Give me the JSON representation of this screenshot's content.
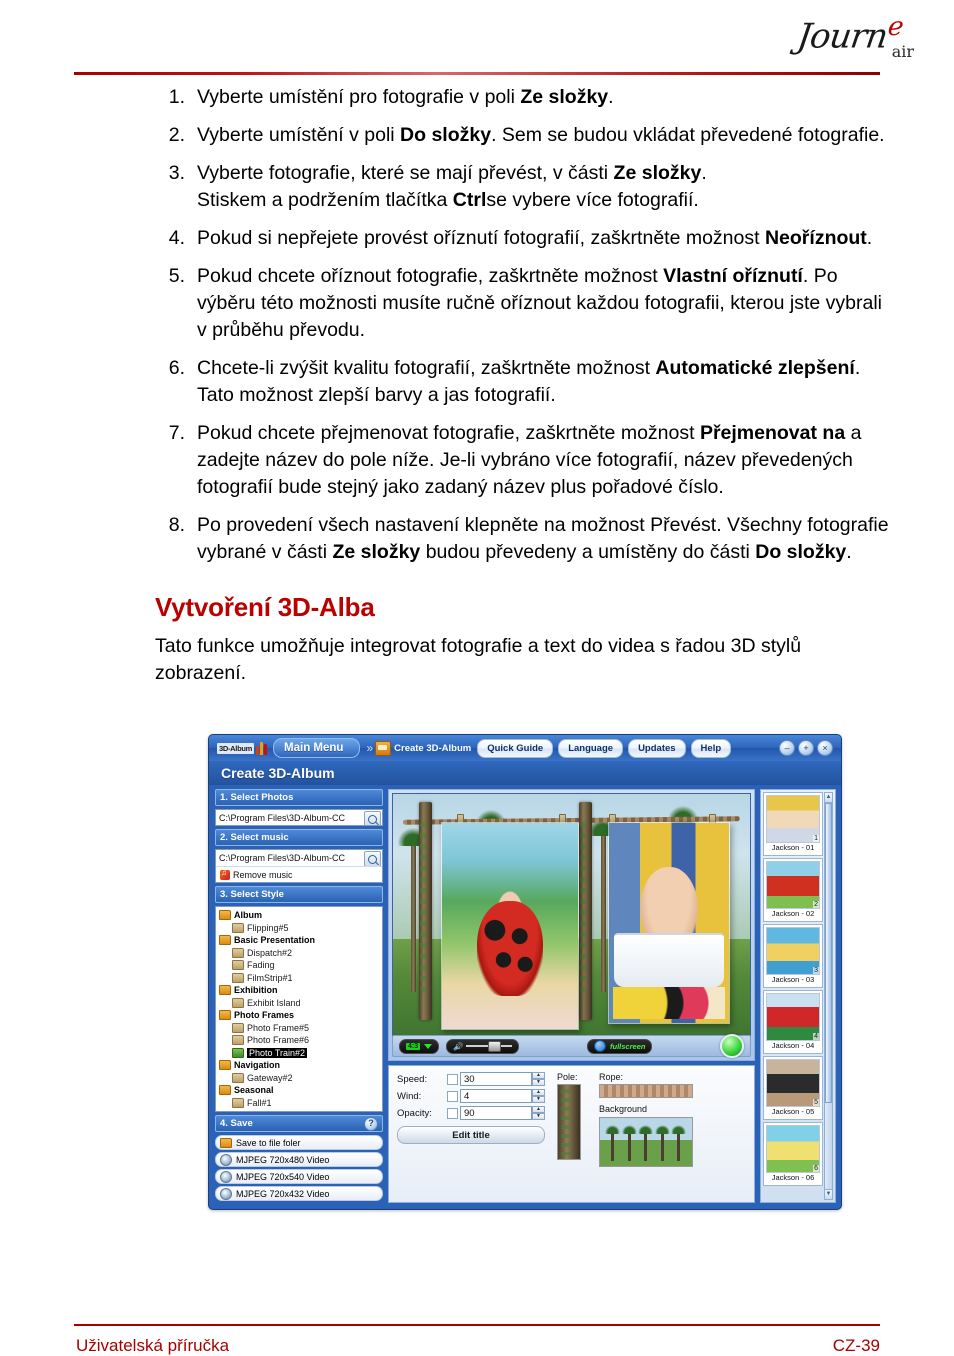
{
  "header": {
    "brand_main": "Journ",
    "brand_accent": "e",
    "brand_sub": "air"
  },
  "steps": [
    {
      "num": "1.",
      "parts": [
        {
          "t": "Vyberte umístění pro fotografie v poli ",
          "b": false
        },
        {
          "t": "Ze složky",
          "b": true
        },
        {
          "t": ".",
          "b": false
        }
      ]
    },
    {
      "num": "2.",
      "parts": [
        {
          "t": "Vyberte umístění v poli ",
          "b": false
        },
        {
          "t": "Do složky",
          "b": true
        },
        {
          "t": ". Sem se budou vkládat převedené fotografie.",
          "b": false
        }
      ]
    },
    {
      "num": "3.",
      "parts": [
        {
          "t": "Vyberte fotografie, které se mají převést, v části ",
          "b": false
        },
        {
          "t": "Ze složky",
          "b": true
        },
        {
          "t": ".",
          "b": false
        },
        {
          "t": "\nStiskem a podržením tlačítka ",
          "b": false
        },
        {
          "t": "Ctrl",
          "b": true
        },
        {
          "t": "se vybere více fotografií.",
          "b": false
        }
      ]
    },
    {
      "num": "4.",
      "parts": [
        {
          "t": "Pokud si nepřejete provést oříznutí fotografií, zaškrtněte možnost ",
          "b": false
        },
        {
          "t": "Neoříznout",
          "b": true
        },
        {
          "t": ".",
          "b": false
        }
      ]
    },
    {
      "num": "5.",
      "parts": [
        {
          "t": "Pokud chcete oříznout fotografie, zaškrtněte možnost ",
          "b": false
        },
        {
          "t": "Vlastní oříznutí",
          "b": true
        },
        {
          "t": ". Po výběru této možnosti musíte ručně oříznout každou fotografii, kterou jste vybrali v průběhu převodu.",
          "b": false
        }
      ]
    },
    {
      "num": "6.",
      "parts": [
        {
          "t": "Chcete-li zvýšit kvalitu fotografií, zaškrtněte možnost ",
          "b": false
        },
        {
          "t": "Automatické zlepšení",
          "b": true
        },
        {
          "t": ". Tato možnost zlepší barvy a jas fotografií.",
          "b": false
        }
      ]
    },
    {
      "num": "7.",
      "parts": [
        {
          "t": "Pokud chcete přejmenovat fotografie, zaškrtněte možnost ",
          "b": false
        },
        {
          "t": "Přejmenovat na",
          "b": true
        },
        {
          "t": " a zadejte název do pole níže. Je-li vybráno více fotografií, název převedených fotografií bude stejný jako zadaný název plus pořadové číslo.",
          "b": false
        }
      ]
    },
    {
      "num": "8.",
      "parts": [
        {
          "t": "Po provedení všech nastavení klepněte na možnost Převést. Všechny fotografie vybrané v části ",
          "b": false
        },
        {
          "t": "Ze složky",
          "b": true
        },
        {
          "t": " budou převedeny a umístěny do části ",
          "b": false
        },
        {
          "t": "Do složky",
          "b": true
        },
        {
          "t": ".",
          "b": false
        }
      ]
    }
  ],
  "section": {
    "title": "Vytvoření 3D-Alba",
    "paragraph": "Tato funkce umožňuje integrovat fotografie a text do videa s řadou 3D stylů zobrazení."
  },
  "app": {
    "logo_text": "3D-Album",
    "main_menu": "Main Menu",
    "toolbar_item_label": "Create 3D-Album",
    "toolbar_buttons": [
      "Quick Guide",
      "Language",
      "Updates",
      "Help"
    ],
    "window_controls": [
      "–",
      "+",
      "×"
    ],
    "subtitle": "Create 3D-Album",
    "sections": {
      "photos": {
        "heading": "1. Select Photos",
        "path": "C:\\Program Files\\3D-Album-CC"
      },
      "music": {
        "heading": "2. Select music",
        "path": "C:\\Program Files\\3D-Album-CC",
        "remove_label": "Remove music"
      },
      "style": {
        "heading": "3. Select Style",
        "tree": [
          {
            "label": "Album",
            "group": true
          },
          {
            "label": "Flipping#5",
            "group": false
          },
          {
            "label": "Basic Presentation",
            "group": true
          },
          {
            "label": "Dispatch#2",
            "group": false
          },
          {
            "label": "Fading",
            "group": false
          },
          {
            "label": "FilmStrip#1",
            "group": false
          },
          {
            "label": "Exhibition",
            "group": true
          },
          {
            "label": "Exhibit Island",
            "group": false
          },
          {
            "label": "Photo Frames",
            "group": true
          },
          {
            "label": "Photo Frame#5",
            "group": false
          },
          {
            "label": "Photo Frame#6",
            "group": false
          },
          {
            "label": "Photo Train#2",
            "group": false,
            "selected": true
          },
          {
            "label": "Navigation",
            "group": true
          },
          {
            "label": "Gateway#2",
            "group": false
          },
          {
            "label": "Seasonal",
            "group": true
          },
          {
            "label": "Fall#1",
            "group": false
          }
        ]
      },
      "save": {
        "heading": "4. Save",
        "help": "?",
        "items": [
          "Save to file foler",
          "MJPEG 720x480 Video",
          "MJPEG 720x540 Video",
          "MJPEG 720x432 Video"
        ]
      }
    },
    "player": {
      "ratio": "4:3",
      "fullscreen_label": "fullscreen"
    },
    "settings": {
      "speed_label": "Speed:",
      "speed_value": "30",
      "wind_label": "Wind:",
      "wind_value": "4",
      "opacity_label": "Opacity:",
      "opacity_value": "90",
      "edit_title_label": "Edit title",
      "pole_label": "Pole:",
      "rope_label": "Rope:",
      "background_label": "Background"
    },
    "thumbnails": [
      {
        "caption": "Jackson - 01",
        "num": "1"
      },
      {
        "caption": "Jackson - 02",
        "num": "2"
      },
      {
        "caption": "Jackson - 03",
        "num": "3"
      },
      {
        "caption": "Jackson - 04",
        "num": "4"
      },
      {
        "caption": "Jackson - 05",
        "num": "5"
      },
      {
        "caption": "Jackson - 06",
        "num": "6"
      }
    ]
  },
  "footer": {
    "left": "Uživatelská příručka",
    "right": "CZ-39"
  }
}
